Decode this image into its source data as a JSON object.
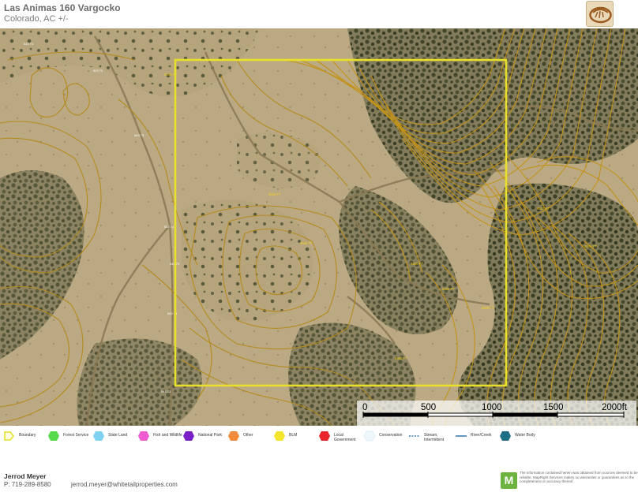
{
  "header": {
    "title": "Las Animas 160 Vargocko",
    "subtitle": "Colorado,  AC +/-"
  },
  "map": {
    "boundary_color": "#e8e02a",
    "contour_color": "#b8860b",
    "road_labels": [
      "543 73",
      "543 73",
      "543 73",
      "543 73",
      "543 73",
      "543 73",
      "543 73"
    ],
    "contour_labels": [
      "6400 FT",
      "6420 FT",
      "6440 FT",
      "6460 FT",
      "6480 FT",
      "6500 FT",
      "6520 FT",
      "6540 FT",
      "6560 FT"
    ],
    "scale": {
      "ticks": [
        "0",
        "500",
        "1000",
        "1500",
        "2000ft"
      ]
    }
  },
  "legend": {
    "items": [
      {
        "label": "Boundary",
        "color": "#e8e02a",
        "icon": "boundary-icon"
      },
      {
        "label": "Forest Service",
        "color": "#56d94a",
        "icon": "forest-service-icon"
      },
      {
        "label": "State Land",
        "color": "#7fd2f0",
        "icon": "state-land-icon"
      },
      {
        "label": "Fish and Wildlife",
        "color": "#f05bd2",
        "icon": "fish-wildlife-icon"
      },
      {
        "label": "National Park",
        "color": "#7a1fc7",
        "icon": "national-park-icon"
      },
      {
        "label": "Other",
        "color": "#f08a3c",
        "icon": "other-icon"
      },
      {
        "label": "BLM",
        "color": "#f5e42c",
        "icon": "blm-icon"
      },
      {
        "label": "Local Government",
        "color": "#e8262b",
        "icon": "local-government-icon"
      },
      {
        "label": "Conservation",
        "color": "#eef7fb",
        "icon": "conservation-icon"
      },
      {
        "label": "Stream, Intermittent",
        "color": "#3a7fb0",
        "icon": "stream-intermittent-icon"
      },
      {
        "label": "River/Creek",
        "color": "#3a7fb0",
        "icon": "river-creek-icon"
      },
      {
        "label": "Water Body",
        "color": "#1f6f86",
        "icon": "water-body-icon"
      }
    ]
  },
  "footer": {
    "agent_name": "Jerrod Meyer",
    "agent_phone": "P: 719-289-8580",
    "agent_email": "jerrod.meyer@whitetailproperties.com",
    "mapright_letter": "M",
    "disclaimer": "The information contained herein was obtained from sources deemed to be reliable. MapRight Services makes no warranties or guarantees as to the completeness or accuracy thereof."
  }
}
